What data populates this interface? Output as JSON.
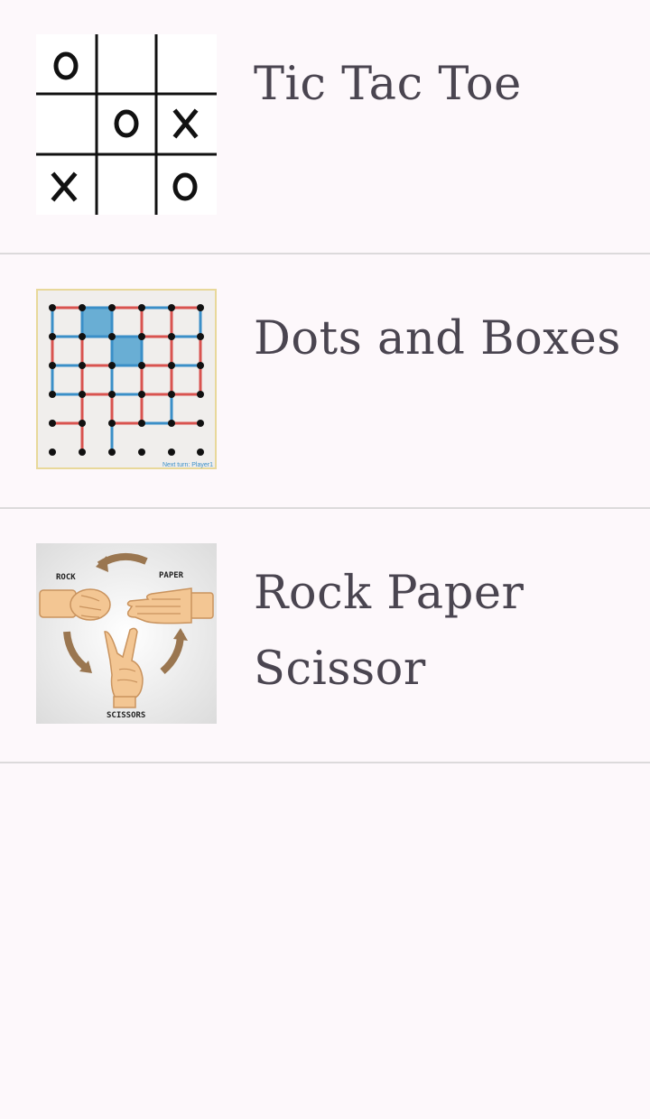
{
  "games": [
    {
      "title": "Tic Tac Toe",
      "thumbnail": "tic-tac-toe-board"
    },
    {
      "title": "Dots and Boxes",
      "thumbnail": "dots-and-boxes-board",
      "caption": "Next turn: Player1"
    },
    {
      "title": "Rock Paper Scissor",
      "thumbnail": "rock-paper-scissors-hands",
      "labels": [
        "ROCK",
        "PAPER",
        "SCISSORS"
      ]
    }
  ]
}
